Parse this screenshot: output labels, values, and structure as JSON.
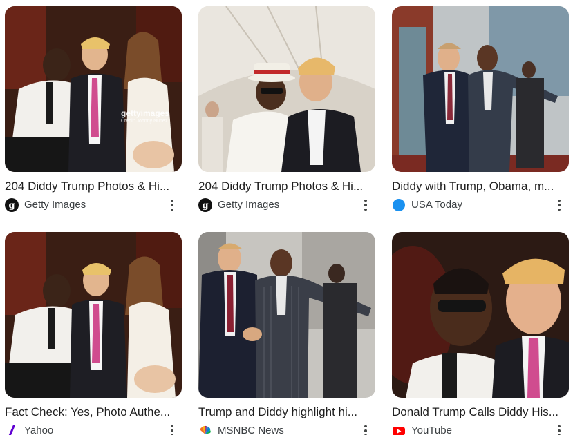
{
  "results": [
    {
      "title": "204 Diddy Trump Photos & Hi...",
      "source": "Getty Images",
      "favicon": "getty-icon",
      "watermark": "gettyimages",
      "credit": "Credit: Johnny Nunez"
    },
    {
      "title": "204 Diddy Trump Photos & Hi...",
      "source": "Getty Images",
      "favicon": "getty-icon"
    },
    {
      "title": "Diddy with Trump, Obama, m...",
      "source": "USA Today",
      "favicon": "usa-today-icon"
    },
    {
      "title": "Fact Check: Yes, Photo Authe...",
      "source": "Yahoo",
      "favicon": "yahoo-icon"
    },
    {
      "title": "Trump and Diddy highlight hi...",
      "source": "MSNBC News",
      "favicon": "msnbc-peacock-icon"
    },
    {
      "title": "Donald Trump Calls Diddy His...",
      "source": "YouTube",
      "favicon": "youtube-icon"
    }
  ],
  "colors": {
    "title": "#1f1f1f",
    "source": "#3c4043",
    "usa_today": "#1a91f0",
    "yahoo": "#6001d2",
    "youtube": "#ff0000"
  }
}
